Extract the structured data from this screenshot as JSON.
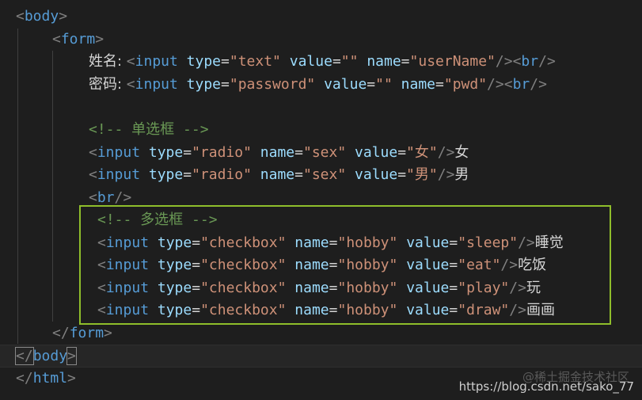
{
  "code": {
    "l1": {
      "open": "<",
      "tag": "body",
      "close": ">"
    },
    "l2": {
      "open": "<",
      "tag": "form",
      "close": ">"
    },
    "l3": {
      "label": "姓名: ",
      "open": "<",
      "tag": "input",
      "a1": "type",
      "eq": "=",
      "v1": "\"text\"",
      "a2": "value",
      "v2": "\"\"",
      "a3": "name",
      "v3": "\"userName\"",
      "selfclose": "/>",
      "br_open": "<",
      "br": "br",
      "br_close": "/>"
    },
    "l4": {
      "label": "密码: ",
      "open": "<",
      "tag": "input",
      "a1": "type",
      "eq": "=",
      "v1": "\"password\"",
      "a2": "value",
      "v2": "\"\"",
      "a3": "name",
      "v3": "\"pwd\"",
      "selfclose": "/>",
      "br_open": "<",
      "br": "br",
      "br_close": "/>"
    },
    "l6": {
      "comment": "<!-- 单选框 -->"
    },
    "l7": {
      "open": "<",
      "tag": "input",
      "a1": "type",
      "eq": "=",
      "v1": "\"radio\"",
      "a2": "name",
      "v2": "\"sex\"",
      "a3": "value",
      "v3": "\"女\"",
      "selfclose": "/>",
      "text": "女"
    },
    "l8": {
      "open": "<",
      "tag": "input",
      "a1": "type",
      "eq": "=",
      "v1": "\"radio\"",
      "a2": "name",
      "v2": "\"sex\"",
      "a3": "value",
      "v3": "\"男\"",
      "selfclose": "/>",
      "text": "男"
    },
    "l9": {
      "open": "<",
      "tag": "br",
      "close": "/>"
    },
    "l10": {
      "comment": "<!-- 多选框 -->"
    },
    "l11": {
      "open": "<",
      "tag": "input",
      "a1": "type",
      "eq": "=",
      "v1": "\"checkbox\"",
      "a2": "name",
      "v2": "\"hobby\"",
      "a3": "value",
      "v3": "\"sleep\"",
      "selfclose": "/>",
      "text": "睡觉"
    },
    "l12": {
      "open": "<",
      "tag": "input",
      "a1": "type",
      "eq": "=",
      "v1": "\"checkbox\"",
      "a2": "name",
      "v2": "\"hobby\"",
      "a3": "value",
      "v3": "\"eat\"",
      "selfclose": "/>",
      "text": "吃饭"
    },
    "l13": {
      "open": "<",
      "tag": "input",
      "a1": "type",
      "eq": "=",
      "v1": "\"checkbox\"",
      "a2": "name",
      "v2": "\"hobby\"",
      "a3": "value",
      "v3": "\"play\"",
      "selfclose": "/>",
      "text": "玩"
    },
    "l14": {
      "open": "<",
      "tag": "input",
      "a1": "type",
      "eq": "=",
      "v1": "\"checkbox\"",
      "a2": "name",
      "v2": "\"hobby\"",
      "a3": "value",
      "v3": "\"draw\"",
      "selfclose": "/>",
      "text": "画画"
    },
    "l15": {
      "open": "</",
      "tag": "form",
      "close": ">"
    },
    "l16": {
      "open": "</",
      "tag": "body",
      "close": ">"
    },
    "l17": {
      "open": "</",
      "tag": "html",
      "close": ">"
    }
  },
  "watermark": {
    "cn": "@稀土掘金技术社区",
    "url": "https://blog.csdn.net/sako_77"
  },
  "colors": {
    "background": "#1e1e1e",
    "tag": "#569cd6",
    "attribute": "#9cdcfe",
    "string": "#ce9178",
    "comment": "#6a9955",
    "highlight_box": "#8fbe2b"
  }
}
